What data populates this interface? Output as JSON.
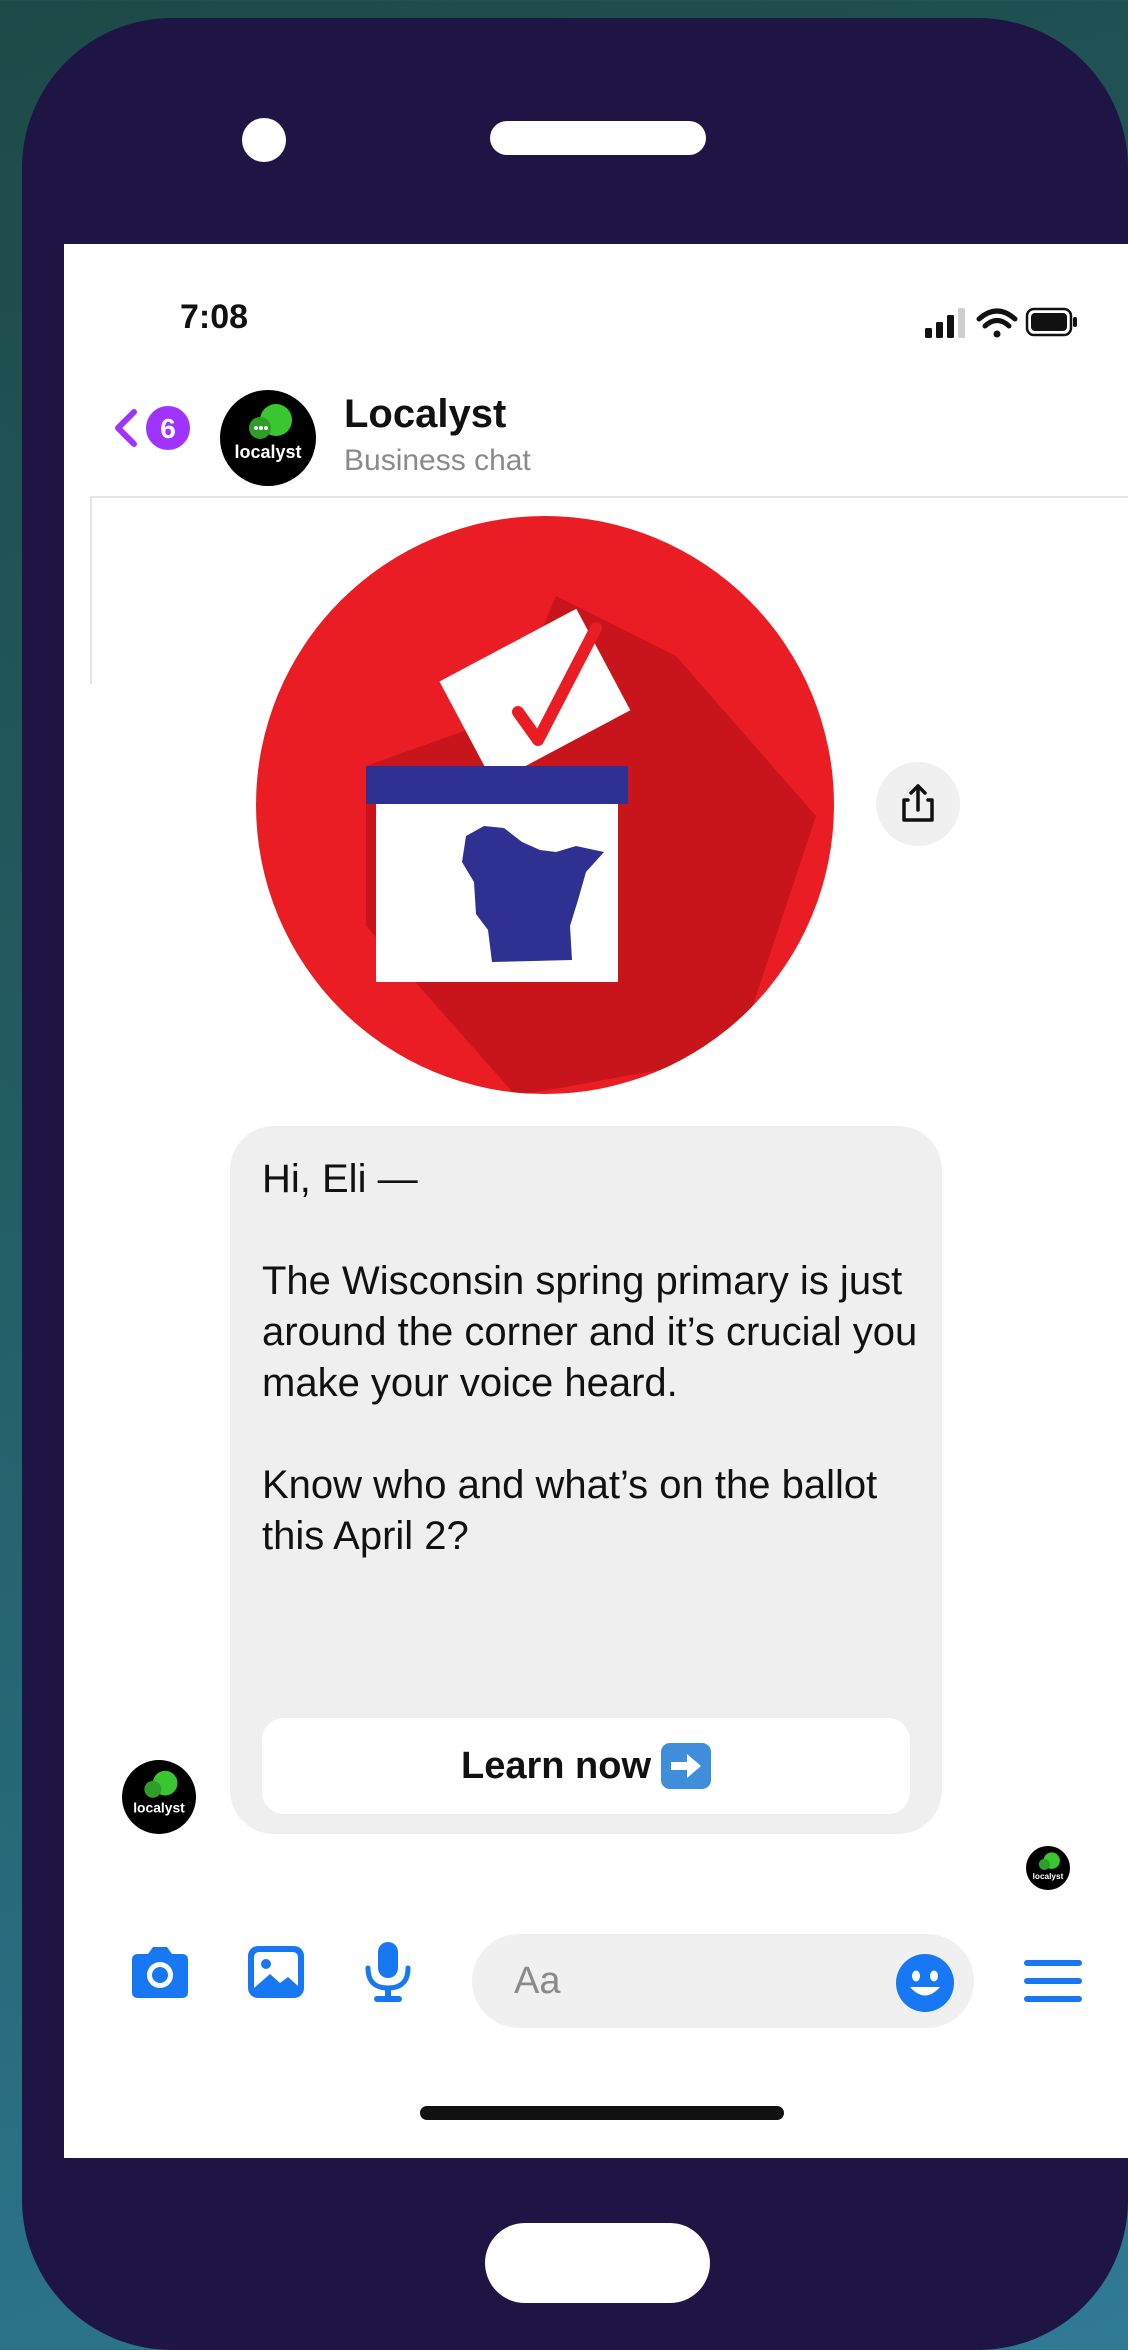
{
  "status_bar": {
    "time": "7:08"
  },
  "header": {
    "back_badge": "6",
    "contact_name": "Localyst",
    "contact_subtitle": "Business chat",
    "avatar_text": "localyst"
  },
  "message": {
    "text": "Hi, Eli —\n\nThe Wisconsin spring primary is just around the corner and it’s crucial you make your voice heard.\n\nKnow who and what’s on the ballot this April 2?",
    "button_label": "Learn now"
  },
  "composer": {
    "placeholder": "Aa"
  },
  "colors": {
    "accent": "#1877f2",
    "back_accent": "#a033ff",
    "frame": "#1f1545",
    "bubble": "#efefef",
    "ballot_red": "#ea1c24",
    "ballot_blue": "#2e3192"
  },
  "icons": [
    "back-chevron-icon",
    "share-icon",
    "camera-icon",
    "image-icon",
    "microphone-icon",
    "emoji-icon",
    "menu-icon",
    "signal-icon",
    "wifi-icon",
    "battery-icon",
    "arrow-right-emoji-icon"
  ]
}
